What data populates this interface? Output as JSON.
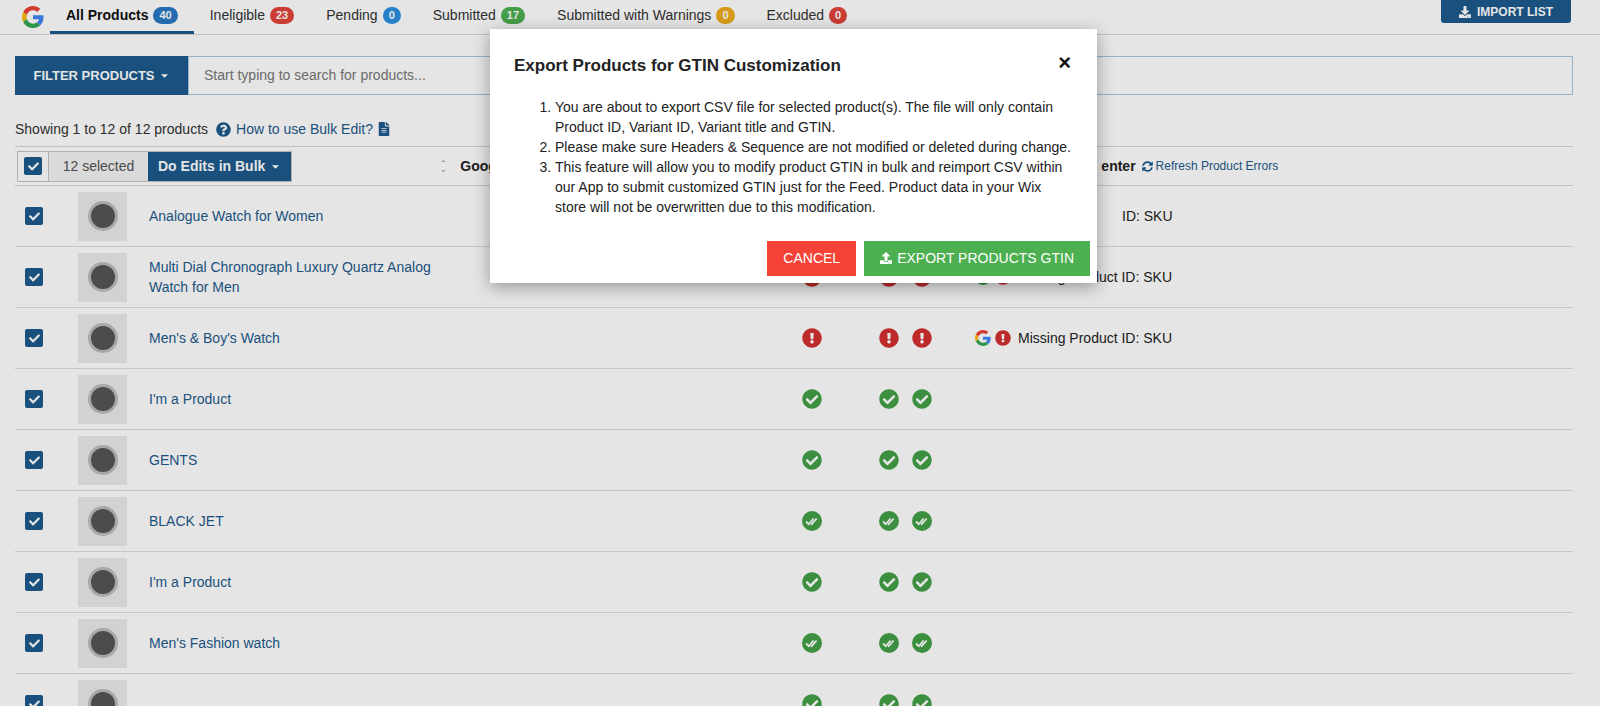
{
  "tabs": [
    {
      "label": "All Products",
      "count": "40",
      "selected": true,
      "color": "#2a78c5"
    },
    {
      "label": "Ineligible",
      "count": "23",
      "selected": false,
      "color": "#e0453a"
    },
    {
      "label": "Pending",
      "count": "0",
      "selected": false,
      "color": "#2a8fe0"
    },
    {
      "label": "Submitted",
      "count": "17",
      "selected": false,
      "color": "#4caf50"
    },
    {
      "label": "Submitted with Warnings",
      "count": "0",
      "selected": false,
      "color": "#f0ad1e"
    },
    {
      "label": "Excluded",
      "count": "0",
      "selected": false,
      "color": "#e0453a"
    }
  ],
  "import_button": "IMPORT LIST",
  "filter": {
    "button": "FILTER PRODUCTS",
    "placeholder": "Start typing to search for products..."
  },
  "summary": {
    "text": "Showing 1 to 12 of 12 products",
    "help_link": "How to use Bulk Edit?"
  },
  "table": {
    "select_all": true,
    "selected_count": "12 selected",
    "bulk_button": "Do Edits in Bulk",
    "columns": [
      "Googl",
      "enter"
    ],
    "refresh": "Refresh Product Errors",
    "rows": [
      {
        "name": "Analogue Watch for Women",
        "checked": true,
        "status": [
          "error",
          "error",
          "error"
        ],
        "merchant": {
          "text": "ID: SKU",
          "covered": true
        }
      },
      {
        "name": "Multi Dial Chronograph Luxury Quartz Analog Watch for Men",
        "checked": true,
        "status": [
          "error",
          "error",
          "error"
        ],
        "merchant": {
          "text": "Missing Product ID: SKU",
          "covered": false
        }
      },
      {
        "name": "Men's & Boy's Watch",
        "checked": true,
        "status": [
          "error",
          "error",
          "error"
        ],
        "merchant": {
          "text": "Missing Product ID: SKU",
          "covered": false
        }
      },
      {
        "name": "I'm a Product",
        "checked": true,
        "status": [
          "check",
          "check",
          "check"
        ],
        "merchant": null
      },
      {
        "name": "GENTS",
        "checked": true,
        "status": [
          "check",
          "check",
          "check"
        ],
        "merchant": null
      },
      {
        "name": "BLACK JET",
        "checked": true,
        "status": [
          "double",
          "double",
          "double"
        ],
        "merchant": null
      },
      {
        "name": "I'm a Product",
        "checked": true,
        "status": [
          "check",
          "check",
          "check"
        ],
        "merchant": null
      },
      {
        "name": "Men's Fashion watch",
        "checked": true,
        "status": [
          "double",
          "double",
          "double"
        ],
        "merchant": null
      },
      {
        "name": "",
        "checked": true,
        "status": [
          "check",
          "check",
          "check"
        ],
        "merchant": null
      }
    ]
  },
  "dialog": {
    "title": "Export Products for GTIN Customization",
    "close": "×",
    "items": [
      "You are about to export CSV file for selected product(s). The file will only contain Product ID, Variant ID, Variant title and GTIN.",
      "Please make sure Headers & Sequence are not modified or deleted during change.",
      "This feature will allow you to modify product GTIN in bulk and reimport CSV within our App to submit customized GTIN just for the Feed. Product data in your Wix store will not be overwritten due to this modification."
    ],
    "cancel": "CANCEL",
    "export": "EXPORT PRODUCTS GTIN"
  }
}
